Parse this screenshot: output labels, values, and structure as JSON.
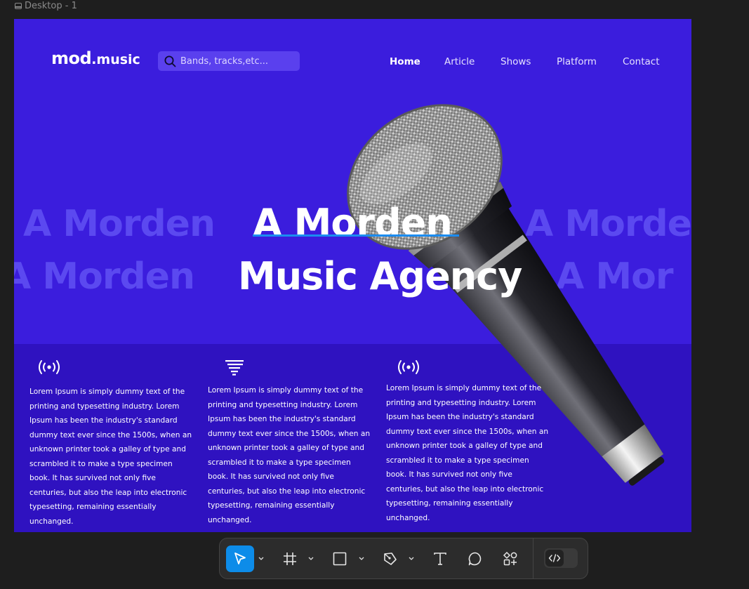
{
  "canvas": {
    "frame_label": "Desktop - 1"
  },
  "site": {
    "logo_main": "mod",
    "logo_sub": ".music",
    "search_placeholder": "Bands, tracks,etc...",
    "nav": [
      {
        "label": "Home",
        "active": true
      },
      {
        "label": "Article",
        "active": false
      },
      {
        "label": "Shows",
        "active": false
      },
      {
        "label": "Platform",
        "active": false
      },
      {
        "label": "Contact",
        "active": false
      }
    ],
    "hero": {
      "line1": "A Morden",
      "line2": "Music Agency",
      "bg_repeat": "A Morden",
      "bg_partial": "A Mor"
    },
    "features": [
      {
        "icon": "broadcast-icon",
        "text": "Lorem Ipsum  is simply dummy text of the printing and typesetting industry. Lorem Ipsum has been the industry's standard dummy text ever since the 1500s, when an unknown printer took a galley of type and scrambled it to make a type specimen book. It has survived not only five centuries, but also the leap into electronic typesetting, remaining essentially unchanged."
      },
      {
        "icon": "tornado-icon",
        "text": "Lorem Ipsum  is simply dummy text of the printing and typesetting industry. Lorem Ipsum has been the industry's standard dummy text ever since the 1500s, when an unknown printer took a galley of type and scrambled it to make a type specimen book. It has survived not only five centuries, but also the leap into electronic typesetting, remaining essentially unchanged."
      },
      {
        "icon": "broadcast-icon",
        "text": "Lorem Ipsum  is simply dummy text of the printing and typesetting industry. Lorem Ipsum has been the industry's standard dummy text ever since the 1500s, when an unknown printer took a galley of type and scrambled it to make a type specimen book. It has survived not only five centuries, but also the leap into electronic typesetting, remaining essentially unchanged."
      }
    ],
    "colors": {
      "background": "#3b1ddd",
      "band": "#2f12c0",
      "ghost_text": "#5b49f0",
      "underline": "#1b8cf0"
    }
  },
  "toolbar": {
    "tools": [
      {
        "name": "move-tool",
        "icon": "cursor-icon",
        "active": true,
        "has_menu": true
      },
      {
        "name": "frame-tool",
        "icon": "frame-icon",
        "active": false,
        "has_menu": true
      },
      {
        "name": "shape-tool",
        "icon": "rectangle-icon",
        "active": false,
        "has_menu": true
      },
      {
        "name": "pen-tool",
        "icon": "pen-icon",
        "active": false,
        "has_menu": true
      },
      {
        "name": "text-tool",
        "icon": "text-icon",
        "active": false,
        "has_menu": false
      },
      {
        "name": "comment-tool",
        "icon": "comment-icon",
        "active": false,
        "has_menu": false
      },
      {
        "name": "actions-tool",
        "icon": "components-icon",
        "active": false,
        "has_menu": false
      },
      {
        "name": "dev-mode-toggle",
        "icon": "code-icon",
        "active": false,
        "has_menu": false
      }
    ],
    "accent": "#0d8ce9"
  }
}
